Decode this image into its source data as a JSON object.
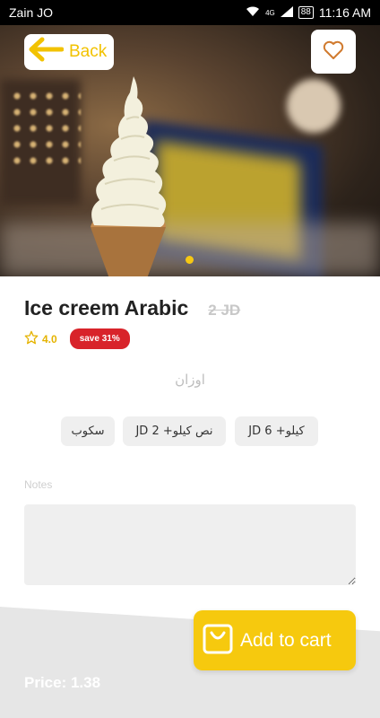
{
  "status_bar": {
    "carrier": "Zain JO",
    "network": "4G",
    "battery": "88",
    "time": "11:16 AM"
  },
  "header": {
    "back_label": "Back"
  },
  "product": {
    "title": "Ice creem Arabic",
    "old_price": "2 JD",
    "rating": "4.0",
    "save_badge": "save 31%",
    "weights_label": "اوزان",
    "options": [
      "سكوب",
      "نص كيلو+ 2 JD",
      "كيلو+ 6 JD"
    ]
  },
  "notes": {
    "label": "Notes"
  },
  "footer": {
    "price": "Price: 1.38",
    "add_to_cart": "Add to cart"
  },
  "colors": {
    "accent": "#f6c90e",
    "badge": "#d8232a",
    "heart": "#d07a2e"
  }
}
